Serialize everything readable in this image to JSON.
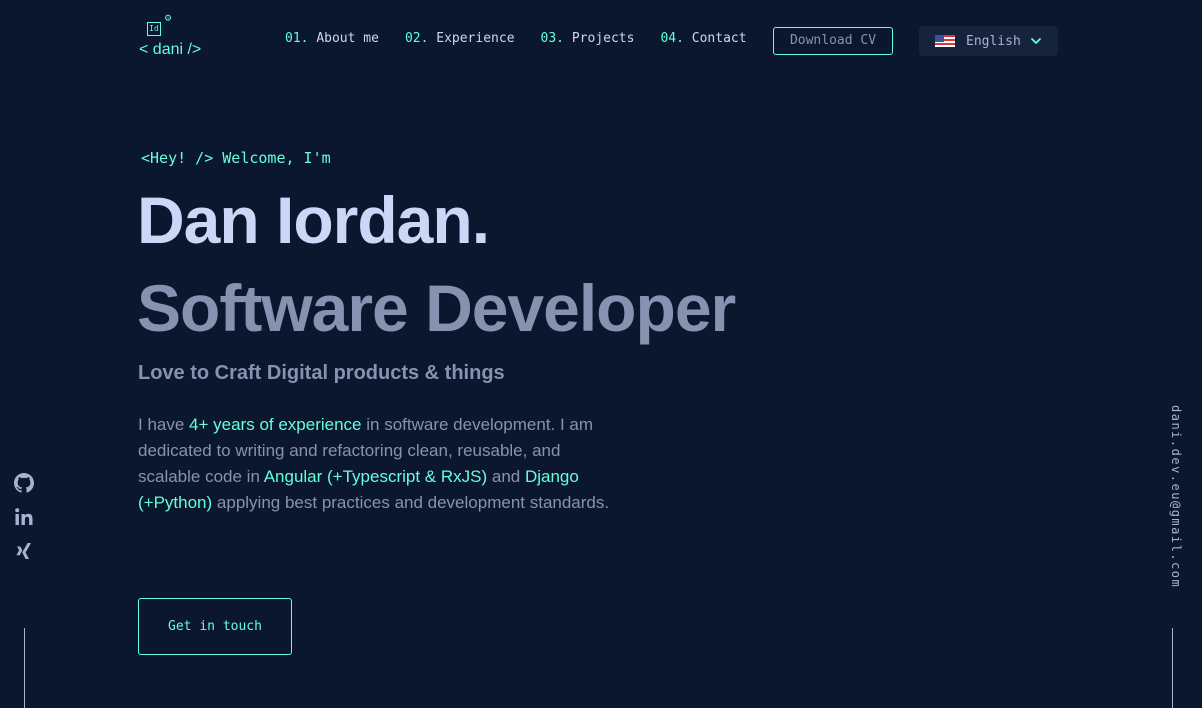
{
  "logo": {
    "badge": "Id",
    "text": "< dani />"
  },
  "nav": [
    {
      "num": "01.",
      "label": "About me"
    },
    {
      "num": "02.",
      "label": "Experience"
    },
    {
      "num": "03.",
      "label": "Projects"
    },
    {
      "num": "04.",
      "label": "Contact"
    }
  ],
  "header": {
    "cv_label": "Download CV",
    "language": "English"
  },
  "hero": {
    "greeting": "<Hey! /> Welcome, I'm",
    "name": "Dan Iordan.",
    "role": "Software Developer",
    "tagline": "Love to Craft Digital products & things",
    "bio": {
      "p1": "I have ",
      "h1": "4+ years of experience",
      "p2": " in software development. I am dedicated to writing and refactoring clean, reusable, and scalable code in ",
      "h2": "Angular (+Typescript & RxJS)",
      "p3": " and ",
      "h3": "Django (+Python)",
      "p4": " applying best practices and development standards."
    },
    "cta_label": "Get in touch"
  },
  "email": "dani.dev.eu@gmail.com",
  "icons": {
    "social": [
      "github-icon",
      "linkedin-icon",
      "xing-icon"
    ]
  },
  "colors": {
    "background": "#0b172e",
    "accent": "#64ffda",
    "heading": "#ccd6f6",
    "text": "#8892b0"
  }
}
